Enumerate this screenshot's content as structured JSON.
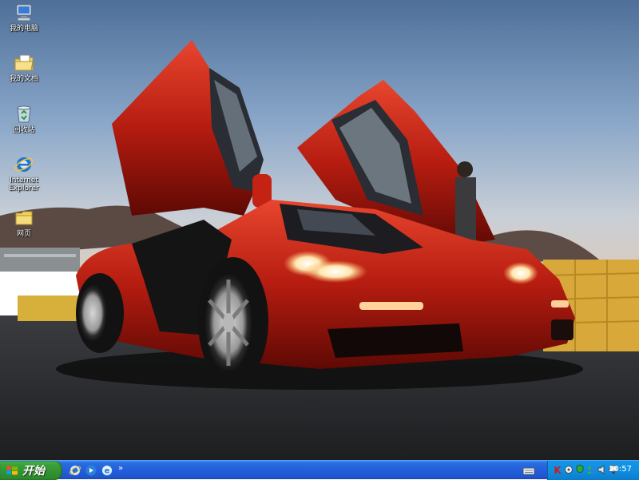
{
  "desktop": {
    "icons": [
      {
        "label": "我的电脑",
        "icon": "my-computer-icon"
      },
      {
        "label": "我的文档",
        "icon": "my-documents-icon"
      },
      {
        "label": "回收站",
        "icon": "recycle-bin-icon"
      },
      {
        "label": "Internet Explorer",
        "icon": "internet-explorer-icon"
      },
      {
        "label": "网页",
        "icon": "folder-icon"
      }
    ],
    "wallpaper": "red-supercar-wallpaper"
  },
  "taskbar": {
    "start_label": "开始",
    "quick_launch": [
      "internet-explorer-icon",
      "media-player-icon",
      "browser-icon"
    ],
    "more_label": "»",
    "tray_icons": [
      "antivirus-k-icon",
      "network-icon",
      "security-icon",
      "messenger-icon",
      "speaker-icon",
      "monitor-icon"
    ],
    "clock": "20:57"
  },
  "colors": {
    "taskbar": "#245edb",
    "start_button": "#329232",
    "tray": "#0f8fe0"
  }
}
